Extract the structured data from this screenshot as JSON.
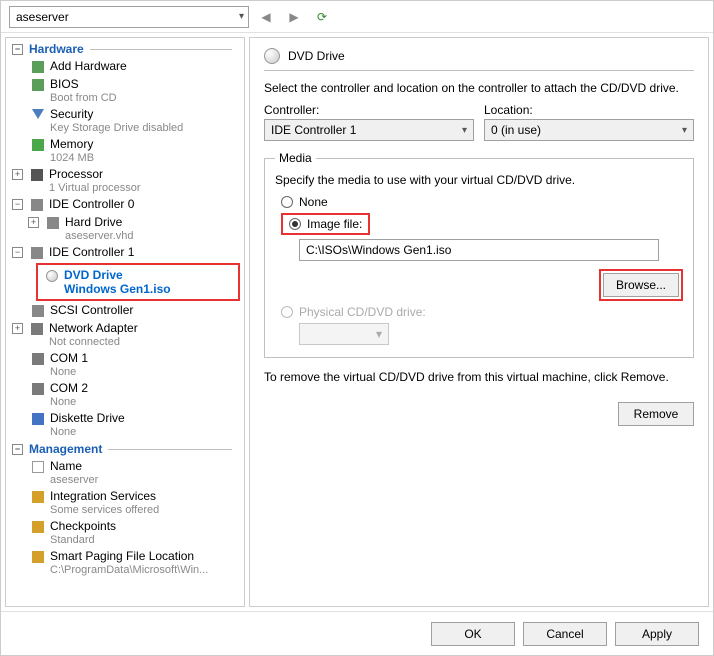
{
  "topbar": {
    "server": "aseserver"
  },
  "tree": {
    "hardware": "Hardware",
    "addHardware": "Add Hardware",
    "bios": "BIOS",
    "biosSub": "Boot from CD",
    "security": "Security",
    "securitySub": "Key Storage Drive disabled",
    "memory": "Memory",
    "memorySub": "1024 MB",
    "processor": "Processor",
    "processorSub": "1 Virtual processor",
    "ide0": "IDE Controller 0",
    "hardDrive": "Hard Drive",
    "hardDriveSub": "aseserver.vhd",
    "ide1": "IDE Controller 1",
    "dvd": "DVD Drive",
    "dvdSub": "Windows Gen1.iso",
    "scsi": "SCSI Controller",
    "net": "Network Adapter",
    "netSub": "Not connected",
    "com1": "COM 1",
    "com1Sub": "None",
    "com2": "COM 2",
    "com2Sub": "None",
    "disk": "Diskette Drive",
    "diskSub": "None",
    "management": "Management",
    "name": "Name",
    "nameSub": "aseserver",
    "integ": "Integration Services",
    "integSub": "Some services offered",
    "check": "Checkpoints",
    "checkSub": "Standard",
    "smart": "Smart Paging File Location",
    "smartSub": "C:\\ProgramData\\Microsoft\\Win..."
  },
  "panel": {
    "title": "DVD Drive",
    "instruction": "Select the controller and location on the controller to attach the CD/DVD drive.",
    "controllerLabel": "Controller:",
    "controllerValue": "IDE Controller 1",
    "locationLabel": "Location:",
    "locationValue": "0 (in use)",
    "mediaLegend": "Media",
    "mediaDesc": "Specify the media to use with your virtual CD/DVD drive.",
    "radioNone": "None",
    "radioImage": "Image file:",
    "imagePath": "C:\\ISOs\\Windows Gen1.iso",
    "browse": "Browse...",
    "radioPhysical": "Physical CD/DVD drive:",
    "removeDesc": "To remove the virtual CD/DVD drive from this virtual machine, click Remove.",
    "remove": "Remove"
  },
  "footer": {
    "ok": "OK",
    "cancel": "Cancel",
    "apply": "Apply"
  }
}
